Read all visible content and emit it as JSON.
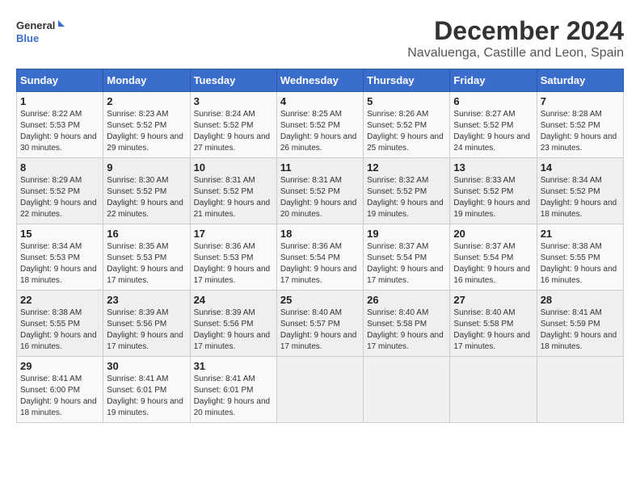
{
  "logo": {
    "line1": "General",
    "line2": "Blue"
  },
  "title": "December 2024",
  "subtitle": "Navaluenga, Castille and Leon, Spain",
  "weekdays": [
    "Sunday",
    "Monday",
    "Tuesday",
    "Wednesday",
    "Thursday",
    "Friday",
    "Saturday"
  ],
  "weeks": [
    [
      {
        "day": "1",
        "sunrise": "8:22 AM",
        "sunset": "5:53 PM",
        "daylight": "9 hours and 30 minutes."
      },
      {
        "day": "2",
        "sunrise": "8:23 AM",
        "sunset": "5:52 PM",
        "daylight": "9 hours and 29 minutes."
      },
      {
        "day": "3",
        "sunrise": "8:24 AM",
        "sunset": "5:52 PM",
        "daylight": "9 hours and 27 minutes."
      },
      {
        "day": "4",
        "sunrise": "8:25 AM",
        "sunset": "5:52 PM",
        "daylight": "9 hours and 26 minutes."
      },
      {
        "day": "5",
        "sunrise": "8:26 AM",
        "sunset": "5:52 PM",
        "daylight": "9 hours and 25 minutes."
      },
      {
        "day": "6",
        "sunrise": "8:27 AM",
        "sunset": "5:52 PM",
        "daylight": "9 hours and 24 minutes."
      },
      {
        "day": "7",
        "sunrise": "8:28 AM",
        "sunset": "5:52 PM",
        "daylight": "9 hours and 23 minutes."
      }
    ],
    [
      {
        "day": "8",
        "sunrise": "8:29 AM",
        "sunset": "5:52 PM",
        "daylight": "9 hours and 22 minutes."
      },
      {
        "day": "9",
        "sunrise": "8:30 AM",
        "sunset": "5:52 PM",
        "daylight": "9 hours and 22 minutes."
      },
      {
        "day": "10",
        "sunrise": "8:31 AM",
        "sunset": "5:52 PM",
        "daylight": "9 hours and 21 minutes."
      },
      {
        "day": "11",
        "sunrise": "8:31 AM",
        "sunset": "5:52 PM",
        "daylight": "9 hours and 20 minutes."
      },
      {
        "day": "12",
        "sunrise": "8:32 AM",
        "sunset": "5:52 PM",
        "daylight": "9 hours and 19 minutes."
      },
      {
        "day": "13",
        "sunrise": "8:33 AM",
        "sunset": "5:52 PM",
        "daylight": "9 hours and 19 minutes."
      },
      {
        "day": "14",
        "sunrise": "8:34 AM",
        "sunset": "5:52 PM",
        "daylight": "9 hours and 18 minutes."
      }
    ],
    [
      {
        "day": "15",
        "sunrise": "8:34 AM",
        "sunset": "5:53 PM",
        "daylight": "9 hours and 18 minutes."
      },
      {
        "day": "16",
        "sunrise": "8:35 AM",
        "sunset": "5:53 PM",
        "daylight": "9 hours and 17 minutes."
      },
      {
        "day": "17",
        "sunrise": "8:36 AM",
        "sunset": "5:53 PM",
        "daylight": "9 hours and 17 minutes."
      },
      {
        "day": "18",
        "sunrise": "8:36 AM",
        "sunset": "5:54 PM",
        "daylight": "9 hours and 17 minutes."
      },
      {
        "day": "19",
        "sunrise": "8:37 AM",
        "sunset": "5:54 PM",
        "daylight": "9 hours and 17 minutes."
      },
      {
        "day": "20",
        "sunrise": "8:37 AM",
        "sunset": "5:54 PM",
        "daylight": "9 hours and 16 minutes."
      },
      {
        "day": "21",
        "sunrise": "8:38 AM",
        "sunset": "5:55 PM",
        "daylight": "9 hours and 16 minutes."
      }
    ],
    [
      {
        "day": "22",
        "sunrise": "8:38 AM",
        "sunset": "5:55 PM",
        "daylight": "9 hours and 16 minutes."
      },
      {
        "day": "23",
        "sunrise": "8:39 AM",
        "sunset": "5:56 PM",
        "daylight": "9 hours and 17 minutes."
      },
      {
        "day": "24",
        "sunrise": "8:39 AM",
        "sunset": "5:56 PM",
        "daylight": "9 hours and 17 minutes."
      },
      {
        "day": "25",
        "sunrise": "8:40 AM",
        "sunset": "5:57 PM",
        "daylight": "9 hours and 17 minutes."
      },
      {
        "day": "26",
        "sunrise": "8:40 AM",
        "sunset": "5:58 PM",
        "daylight": "9 hours and 17 minutes."
      },
      {
        "day": "27",
        "sunrise": "8:40 AM",
        "sunset": "5:58 PM",
        "daylight": "9 hours and 17 minutes."
      },
      {
        "day": "28",
        "sunrise": "8:41 AM",
        "sunset": "5:59 PM",
        "daylight": "9 hours and 18 minutes."
      }
    ],
    [
      {
        "day": "29",
        "sunrise": "8:41 AM",
        "sunset": "6:00 PM",
        "daylight": "9 hours and 18 minutes."
      },
      {
        "day": "30",
        "sunrise": "8:41 AM",
        "sunset": "6:01 PM",
        "daylight": "9 hours and 19 minutes."
      },
      {
        "day": "31",
        "sunrise": "8:41 AM",
        "sunset": "6:01 PM",
        "daylight": "9 hours and 20 minutes."
      },
      null,
      null,
      null,
      null
    ]
  ],
  "labels": {
    "sunrise": "Sunrise: ",
    "sunset": "Sunset: ",
    "daylight": "Daylight: "
  }
}
